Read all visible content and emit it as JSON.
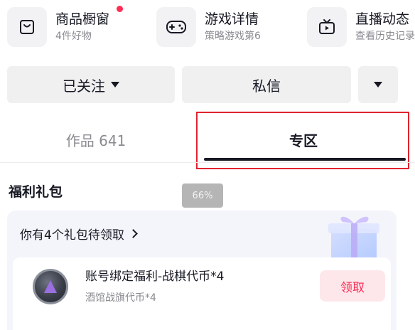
{
  "shortcuts": [
    {
      "title": "商品橱窗",
      "subtitle": "4件好物",
      "icon": "bag-icon",
      "has_badge": true
    },
    {
      "title": "游戏详情",
      "subtitle": "策略游戏第6",
      "icon": "gamepad-icon",
      "has_badge": false
    },
    {
      "title": "直播动态",
      "subtitle": "查看历史记录",
      "icon": "tv-icon",
      "has_badge": false
    }
  ],
  "actions": {
    "follow_label": "已关注",
    "message_label": "私信"
  },
  "tabs": {
    "works_label": "作品 641",
    "zone_label": "专区"
  },
  "overlay_badge": "66%",
  "section": {
    "title": "福利礼包"
  },
  "gift_card": {
    "header": "你有4个礼包待领取",
    "item": {
      "title": "账号绑定福利-战棋代币*4",
      "subtitle": "酒馆战旗代币*4",
      "claim_label": "领取"
    }
  },
  "colors": {
    "accent": "#fe2c55",
    "highlight_border": "#e0242e",
    "button_bg": "#f0f0f1",
    "card_bg": "#f4f5fa"
  }
}
